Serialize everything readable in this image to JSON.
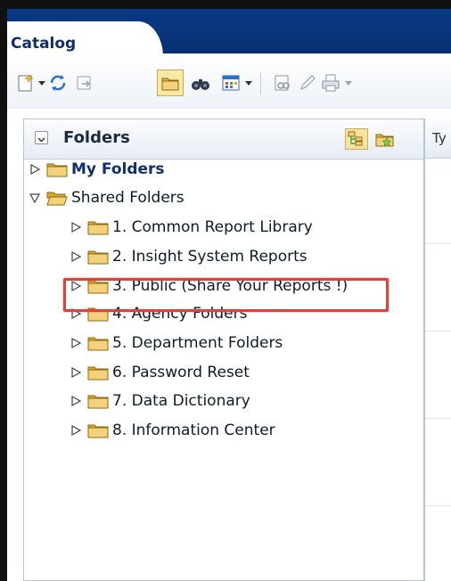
{
  "window": {
    "title": "Catalog"
  },
  "toolbar": {
    "icons": [
      "new-icon",
      "refresh-icon",
      "move-icon",
      "folder-view-icon",
      "search-binoculars-icon",
      "view-options-icon",
      "share-icon",
      "edit-icon",
      "print-icon"
    ]
  },
  "folders_pane": {
    "title": "Folders",
    "header_buttons": [
      "tree-view-icon",
      "favorites-folder-icon"
    ]
  },
  "right_column": {
    "header": "Ty"
  },
  "tree": [
    {
      "label": "My Folders",
      "expanded": false,
      "bold": true,
      "level": 0
    },
    {
      "label": "Shared Folders",
      "expanded": true,
      "bold": false,
      "level": 0
    },
    {
      "label": "1. Common Report Library",
      "expanded": false,
      "level": 1
    },
    {
      "label": "2. Insight System Reports",
      "expanded": false,
      "level": 1
    },
    {
      "label": "3. Public (Share Your Reports !)",
      "expanded": false,
      "level": 1,
      "highlighted": true
    },
    {
      "label": "4. Agency Folders",
      "expanded": false,
      "level": 1
    },
    {
      "label": "5. Department Folders",
      "expanded": false,
      "level": 1
    },
    {
      "label": "6. Password Reset",
      "expanded": false,
      "level": 1
    },
    {
      "label": "7. Data Dictionary",
      "expanded": false,
      "level": 1
    },
    {
      "label": "8. Information Center",
      "expanded": false,
      "level": 1
    }
  ],
  "colors": {
    "title_bar": "#0a3b86",
    "highlight": "#e0413d",
    "folder_fill": "#f4d27a"
  }
}
